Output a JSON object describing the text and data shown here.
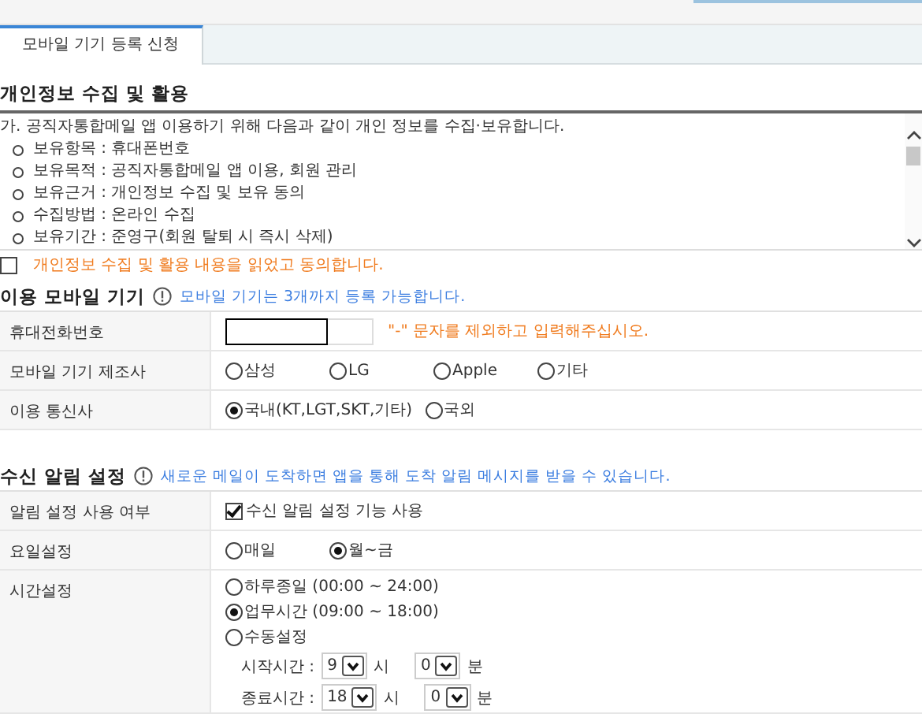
{
  "tabs": [
    {
      "label": "모바일 기기 등록 신청",
      "selected": true
    }
  ],
  "privacy": {
    "title": "개인정보 수집 및 활용",
    "intro": "가. 공직자통합메일 앱 이용하기 위해 다음과 같이 개인 정보를 수집·보유합니다.",
    "items": [
      "보유항목 : 휴대폰번호",
      "보유목적 : 공직자통합메일 앱 이용, 회원 관리",
      "보유근거 : 개인정보 수집 및 보유 동의",
      "수집방법 : 온라인 수집",
      "보유기간 : 준영구(회원 탈퇴 시 즉시 삭제)"
    ],
    "agree": {
      "label": "개인정보 수집 및 활용 내용을 읽었고 동의합니다.",
      "checked": false
    }
  },
  "sections": [
    {
      "title": "이용 모바일 기기",
      "note": "모바일 기기는 3개까지 등록 가능합니다.",
      "rows": [
        {
          "label": "휴대전화번호",
          "kind": "text",
          "hint": "\"-\" 문자를 제외하고 입력해주십시오."
        },
        {
          "label": "모바일 기기 제조사",
          "kind": "radio",
          "options": [
            {
              "label": "삼성",
              "selected": false
            },
            {
              "label": "LG",
              "selected": false
            },
            {
              "label": "Apple",
              "selected": false
            },
            {
              "label": "기타",
              "selected": false
            }
          ]
        },
        {
          "label": "이용 통신사",
          "kind": "radio",
          "options": [
            {
              "label": "국내(KT,LGT,SKT,기타)",
              "selected": true
            },
            {
              "label": "국외",
              "selected": false
            }
          ]
        }
      ]
    },
    {
      "title": "수신 알림 설정",
      "note": "새로운 메일이 도착하면 앱을 통해 도착 알림 메시지를 받을 수 있습니다.",
      "rows": [
        {
          "label": "알림 설정 사용 여부",
          "kind": "check",
          "options": [
            {
              "label": "수신 알림 설정 기능 사용",
              "checked": true
            }
          ]
        },
        {
          "label": "요일설정",
          "kind": "radio",
          "options": [
            {
              "label": "매일",
              "selected": false
            },
            {
              "label": "월~금",
              "selected": true
            }
          ]
        },
        {
          "label": "시간설정",
          "kind": "time",
          "options": [
            {
              "label": "하루종일 (00:00 ~ 24:00)",
              "selected": false
            },
            {
              "label": "업무시간 (09:00 ~ 18:00)",
              "selected": true
            },
            {
              "label": "수동설정",
              "selected": false
            }
          ],
          "times": [
            {
              "label": "시작시간 :",
              "hour": "9",
              "hour_unit": "시",
              "minute": "0",
              "minute_unit": "분"
            },
            {
              "label": "종료시간 :",
              "hour": "18",
              "hour_unit": "시",
              "minute": "0",
              "minute_unit": "분"
            }
          ]
        }
      ]
    }
  ]
}
